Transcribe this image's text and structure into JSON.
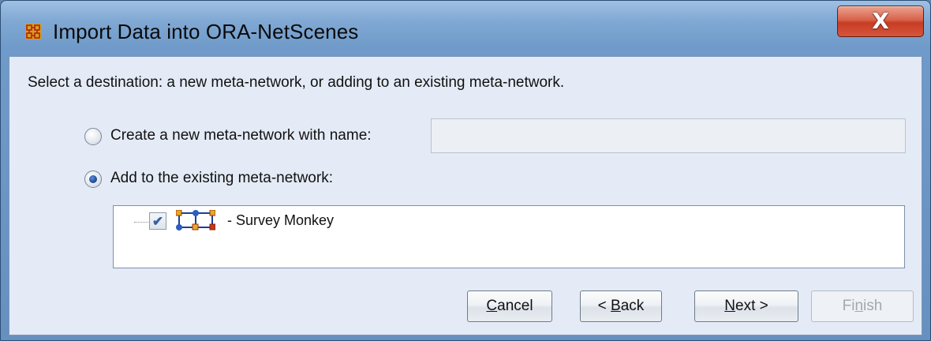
{
  "window": {
    "title": "Import Data into ORA-NetScenes",
    "close_label": "X"
  },
  "content": {
    "instruction": "Select a destination: a new meta-network, or adding to an existing meta-network.",
    "option_new": {
      "label": "Create a new meta-network with name:",
      "selected": false,
      "name_value": ""
    },
    "option_existing": {
      "label": "Add to the existing meta-network:",
      "selected": true
    },
    "tree": {
      "items": [
        {
          "label": "- Survey Monkey",
          "checked": true,
          "icon": "meta-network-icon"
        }
      ]
    }
  },
  "buttons": {
    "cancel": {
      "pre": "",
      "mnemonic": "C",
      "post": "ancel"
    },
    "back": {
      "pre": "< ",
      "mnemonic": "B",
      "post": "ack"
    },
    "next": {
      "pre": "",
      "mnemonic": "N",
      "post": "ext >"
    },
    "finish": {
      "pre": "Fi",
      "mnemonic": "n",
      "post": "ish",
      "disabled": true
    }
  },
  "colors": {
    "titlebar": "#80a8d3",
    "content_bg": "#e4ebf6",
    "close_button": "#c73c25",
    "radio_selected": "#1f4f9e"
  }
}
